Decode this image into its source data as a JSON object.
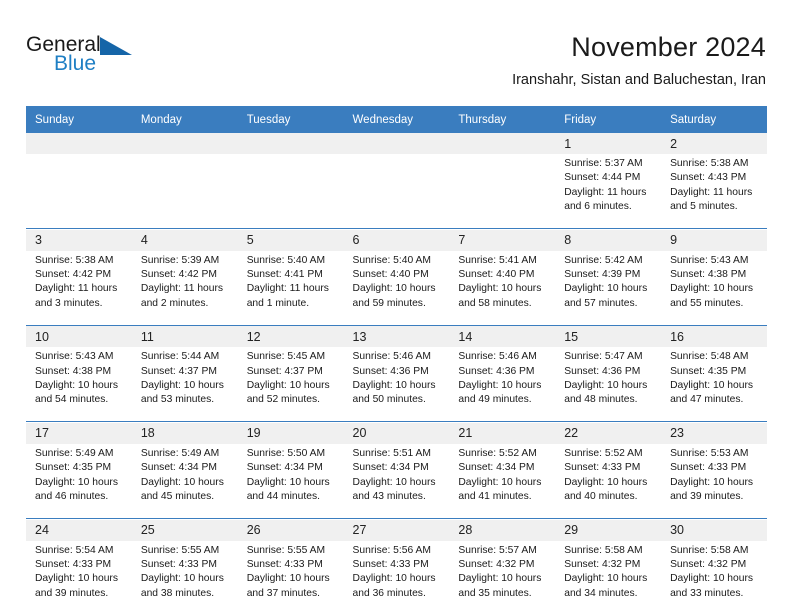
{
  "brand": {
    "name_part1": "General",
    "name_part2": "Blue",
    "triangle_icon": "triangle-icon",
    "accent_color": "#1565a8",
    "blue_text_color": "#1f7fc4"
  },
  "header": {
    "title": "November 2024",
    "subtitle": "Iranshahr, Sistan and Baluchestan, Iran"
  },
  "calendar": {
    "header_bg": "#3a7dbf",
    "daynum_bg": "#f0f0f0",
    "weekdays": [
      "Sunday",
      "Monday",
      "Tuesday",
      "Wednesday",
      "Thursday",
      "Friday",
      "Saturday"
    ],
    "weeks": [
      [
        {
          "day": "",
          "lines": []
        },
        {
          "day": "",
          "lines": []
        },
        {
          "day": "",
          "lines": []
        },
        {
          "day": "",
          "lines": []
        },
        {
          "day": "",
          "lines": []
        },
        {
          "day": "1",
          "lines": [
            "Sunrise: 5:37 AM",
            "Sunset: 4:44 PM",
            "Daylight: 11 hours",
            "and 6 minutes."
          ]
        },
        {
          "day": "2",
          "lines": [
            "Sunrise: 5:38 AM",
            "Sunset: 4:43 PM",
            "Daylight: 11 hours",
            "and 5 minutes."
          ]
        }
      ],
      [
        {
          "day": "3",
          "lines": [
            "Sunrise: 5:38 AM",
            "Sunset: 4:42 PM",
            "Daylight: 11 hours",
            "and 3 minutes."
          ]
        },
        {
          "day": "4",
          "lines": [
            "Sunrise: 5:39 AM",
            "Sunset: 4:42 PM",
            "Daylight: 11 hours",
            "and 2 minutes."
          ]
        },
        {
          "day": "5",
          "lines": [
            "Sunrise: 5:40 AM",
            "Sunset: 4:41 PM",
            "Daylight: 11 hours",
            "and 1 minute."
          ]
        },
        {
          "day": "6",
          "lines": [
            "Sunrise: 5:40 AM",
            "Sunset: 4:40 PM",
            "Daylight: 10 hours",
            "and 59 minutes."
          ]
        },
        {
          "day": "7",
          "lines": [
            "Sunrise: 5:41 AM",
            "Sunset: 4:40 PM",
            "Daylight: 10 hours",
            "and 58 minutes."
          ]
        },
        {
          "day": "8",
          "lines": [
            "Sunrise: 5:42 AM",
            "Sunset: 4:39 PM",
            "Daylight: 10 hours",
            "and 57 minutes."
          ]
        },
        {
          "day": "9",
          "lines": [
            "Sunrise: 5:43 AM",
            "Sunset: 4:38 PM",
            "Daylight: 10 hours",
            "and 55 minutes."
          ]
        }
      ],
      [
        {
          "day": "10",
          "lines": [
            "Sunrise: 5:43 AM",
            "Sunset: 4:38 PM",
            "Daylight: 10 hours",
            "and 54 minutes."
          ]
        },
        {
          "day": "11",
          "lines": [
            "Sunrise: 5:44 AM",
            "Sunset: 4:37 PM",
            "Daylight: 10 hours",
            "and 53 minutes."
          ]
        },
        {
          "day": "12",
          "lines": [
            "Sunrise: 5:45 AM",
            "Sunset: 4:37 PM",
            "Daylight: 10 hours",
            "and 52 minutes."
          ]
        },
        {
          "day": "13",
          "lines": [
            "Sunrise: 5:46 AM",
            "Sunset: 4:36 PM",
            "Daylight: 10 hours",
            "and 50 minutes."
          ]
        },
        {
          "day": "14",
          "lines": [
            "Sunrise: 5:46 AM",
            "Sunset: 4:36 PM",
            "Daylight: 10 hours",
            "and 49 minutes."
          ]
        },
        {
          "day": "15",
          "lines": [
            "Sunrise: 5:47 AM",
            "Sunset: 4:36 PM",
            "Daylight: 10 hours",
            "and 48 minutes."
          ]
        },
        {
          "day": "16",
          "lines": [
            "Sunrise: 5:48 AM",
            "Sunset: 4:35 PM",
            "Daylight: 10 hours",
            "and 47 minutes."
          ]
        }
      ],
      [
        {
          "day": "17",
          "lines": [
            "Sunrise: 5:49 AM",
            "Sunset: 4:35 PM",
            "Daylight: 10 hours",
            "and 46 minutes."
          ]
        },
        {
          "day": "18",
          "lines": [
            "Sunrise: 5:49 AM",
            "Sunset: 4:34 PM",
            "Daylight: 10 hours",
            "and 45 minutes."
          ]
        },
        {
          "day": "19",
          "lines": [
            "Sunrise: 5:50 AM",
            "Sunset: 4:34 PM",
            "Daylight: 10 hours",
            "and 44 minutes."
          ]
        },
        {
          "day": "20",
          "lines": [
            "Sunrise: 5:51 AM",
            "Sunset: 4:34 PM",
            "Daylight: 10 hours",
            "and 43 minutes."
          ]
        },
        {
          "day": "21",
          "lines": [
            "Sunrise: 5:52 AM",
            "Sunset: 4:34 PM",
            "Daylight: 10 hours",
            "and 41 minutes."
          ]
        },
        {
          "day": "22",
          "lines": [
            "Sunrise: 5:52 AM",
            "Sunset: 4:33 PM",
            "Daylight: 10 hours",
            "and 40 minutes."
          ]
        },
        {
          "day": "23",
          "lines": [
            "Sunrise: 5:53 AM",
            "Sunset: 4:33 PM",
            "Daylight: 10 hours",
            "and 39 minutes."
          ]
        }
      ],
      [
        {
          "day": "24",
          "lines": [
            "Sunrise: 5:54 AM",
            "Sunset: 4:33 PM",
            "Daylight: 10 hours",
            "and 39 minutes."
          ]
        },
        {
          "day": "25",
          "lines": [
            "Sunrise: 5:55 AM",
            "Sunset: 4:33 PM",
            "Daylight: 10 hours",
            "and 38 minutes."
          ]
        },
        {
          "day": "26",
          "lines": [
            "Sunrise: 5:55 AM",
            "Sunset: 4:33 PM",
            "Daylight: 10 hours",
            "and 37 minutes."
          ]
        },
        {
          "day": "27",
          "lines": [
            "Sunrise: 5:56 AM",
            "Sunset: 4:33 PM",
            "Daylight: 10 hours",
            "and 36 minutes."
          ]
        },
        {
          "day": "28",
          "lines": [
            "Sunrise: 5:57 AM",
            "Sunset: 4:32 PM",
            "Daylight: 10 hours",
            "and 35 minutes."
          ]
        },
        {
          "day": "29",
          "lines": [
            "Sunrise: 5:58 AM",
            "Sunset: 4:32 PM",
            "Daylight: 10 hours",
            "and 34 minutes."
          ]
        },
        {
          "day": "30",
          "lines": [
            "Sunrise: 5:58 AM",
            "Sunset: 4:32 PM",
            "Daylight: 10 hours",
            "and 33 minutes."
          ]
        }
      ]
    ]
  }
}
